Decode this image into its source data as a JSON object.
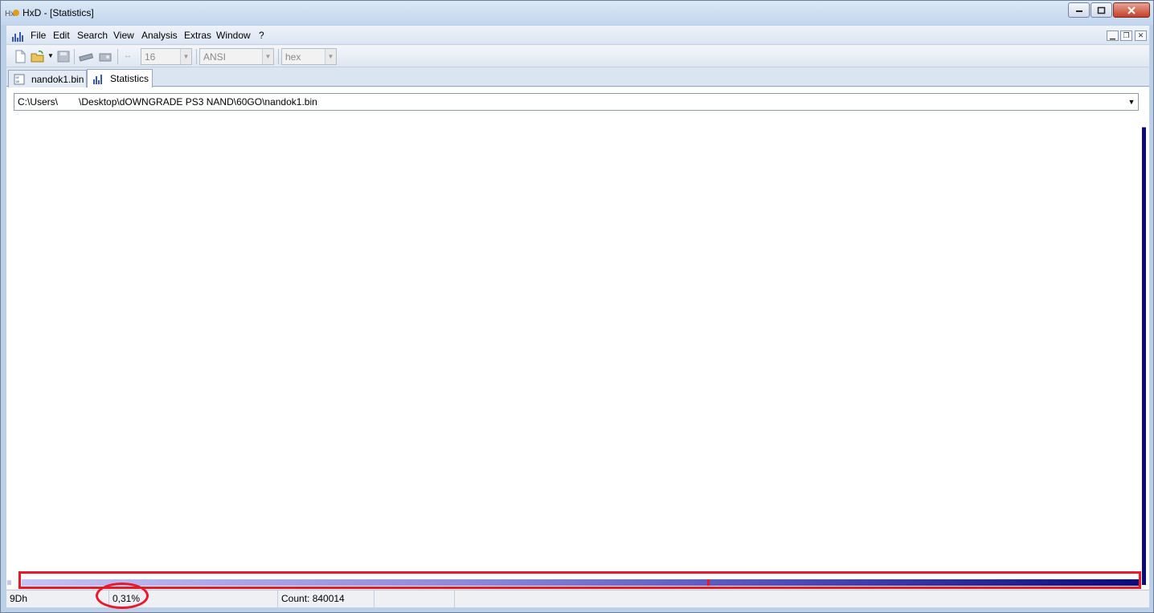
{
  "window": {
    "title": "HxD - [Statistics]"
  },
  "menubar": {
    "items": [
      "File",
      "Edit",
      "Search",
      "View",
      "Analysis",
      "Extras",
      "Window",
      "?"
    ]
  },
  "toolbar": {
    "bytes_per_row": "16",
    "charset": "ANSI",
    "offset_base": "hex",
    "icons": [
      "new-file-icon",
      "open-file-icon",
      "save-icon",
      "ram-icon",
      "disk-icon",
      "row-width-icon"
    ]
  },
  "tabs": [
    {
      "label": "nandok1.bin",
      "icon": "hex-file-icon",
      "active": false
    },
    {
      "label": "Statistics",
      "icon": "histogram-icon",
      "active": true
    }
  ],
  "statistics": {
    "file_path_prefix": "C:\\Users\\",
    "file_path_suffix": "\\Desktop\\dOWNGRADE PS3 NAND\\60GO\\nandok1.bin",
    "chart_data": {
      "type": "bar",
      "categories_range": [
        "00h",
        "FFh"
      ],
      "values_fraction": {
        "00h": 0.01,
        "FFh": 0.98
      },
      "colors": {
        "low": "#c6c2f2",
        "mid": "#4c49b4",
        "high": "#0b0a78",
        "marker": "#e8192c"
      }
    }
  },
  "status": {
    "byte": "9Dh",
    "percent": "0,31%",
    "count": "Count: 840014"
  },
  "colors": {
    "annotation_red": "#e8192c",
    "bar_navy": "#0b0a78"
  }
}
